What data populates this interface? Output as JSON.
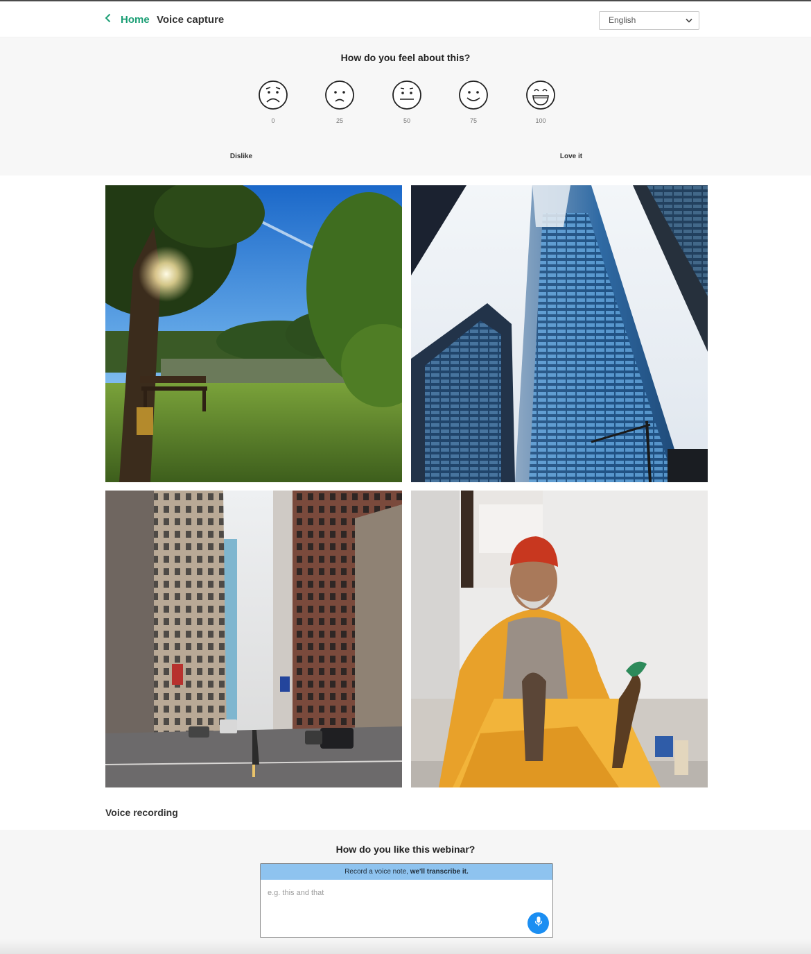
{
  "header": {
    "back_label": "Home",
    "title": "Voice capture",
    "language": "English"
  },
  "rating": {
    "question": "How do you feel about this?",
    "options": [
      {
        "value": "0",
        "face": "very-sad-face-icon"
      },
      {
        "value": "25",
        "face": "sad-face-icon"
      },
      {
        "value": "50",
        "face": "neutral-face-icon"
      },
      {
        "value": "75",
        "face": "happy-face-icon"
      },
      {
        "value": "100",
        "face": "very-happy-face-icon"
      }
    ],
    "min_label": "Dislike",
    "max_label": "Love it"
  },
  "gallery": {
    "images": [
      {
        "name": "park-bench-photo"
      },
      {
        "name": "skyscraper-photo"
      },
      {
        "name": "city-street-photo"
      },
      {
        "name": "seated-man-photo"
      }
    ]
  },
  "voice": {
    "heading": "Voice recording",
    "question": "How do you like this webinar?",
    "banner_text": "Record a voice note,",
    "banner_bold": "we'll transcribe it.",
    "placeholder": "e.g. this and that",
    "value": ""
  },
  "colors": {
    "accent_green": "#1a9e74",
    "banner_blue": "#8ec3ef",
    "mic_blue": "#1b8ef2"
  }
}
